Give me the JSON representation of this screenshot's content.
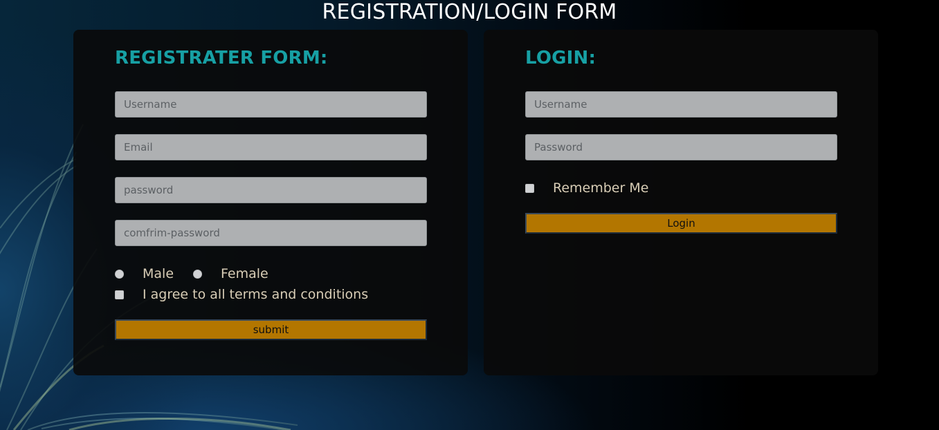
{
  "page": {
    "title": "REGISTRATION/LOGIN FORM"
  },
  "register": {
    "title": "REGISTRATER FORM:",
    "username_placeholder": "Username",
    "email_placeholder": "Email",
    "password_placeholder": "password",
    "confirm_placeholder": "comfrim-password",
    "gender_options": [
      "Male",
      "Female"
    ],
    "terms_label": "I agree to all terms and conditions",
    "submit_label": "submit"
  },
  "login": {
    "title": "LOGIN:",
    "username_placeholder": "Username",
    "password_placeholder": "Password",
    "remember_label": "Remember Me",
    "submit_label": "Login"
  },
  "colors": {
    "accent_title": "#17a0a4",
    "button": "#b37600",
    "option_text": "#d8cdb6"
  }
}
